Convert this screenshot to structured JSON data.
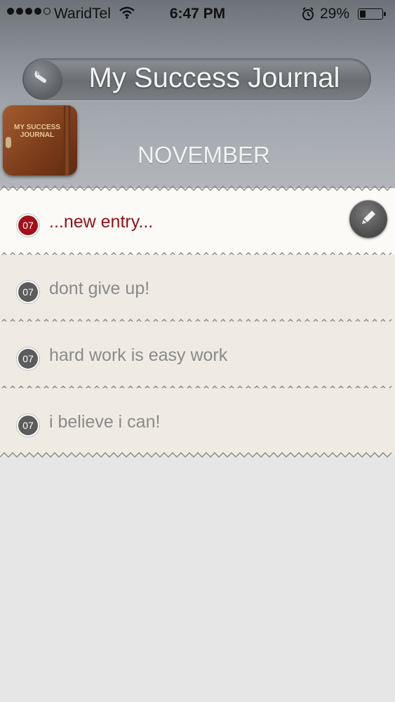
{
  "status_bar": {
    "carrier": "WaridTel",
    "time": "6:47 PM",
    "battery_percent": "29%",
    "battery_level": 0.29,
    "signal_bars": 4,
    "signal_max": 5
  },
  "header": {
    "app_title": "My Success Journal",
    "month": "NOVEMBER",
    "journal_icon_text": "MY SUCCESS JOURNAL"
  },
  "entries": [
    {
      "day": "07",
      "text": "...new entry...",
      "active": true
    },
    {
      "day": "07",
      "text": "dont give up!",
      "active": false
    },
    {
      "day": "07",
      "text": "hard work is easy work",
      "active": false
    },
    {
      "day": "07",
      "text": "i believe i can!",
      "active": false
    }
  ],
  "colors": {
    "accent_red": "#a3101a",
    "badge_gray": "#5c5c5c"
  },
  "icons": [
    "signal-icon",
    "wifi-icon",
    "alarm-icon",
    "battery-icon",
    "wrench-icon",
    "pencil-icon"
  ]
}
